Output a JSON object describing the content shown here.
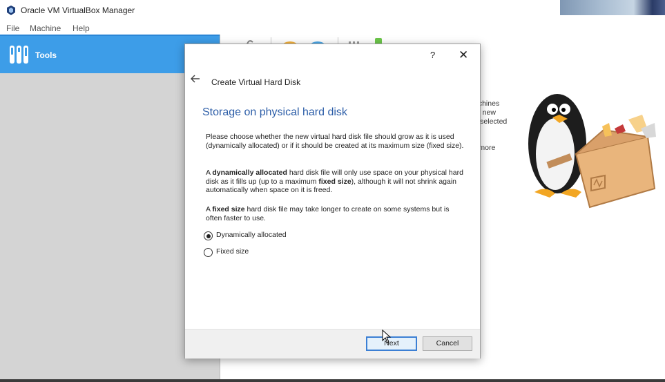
{
  "window": {
    "title": "Oracle VM VirtualBox Manager"
  },
  "menu": {
    "items": [
      "File",
      "Machine",
      "Help"
    ]
  },
  "sidebar": {
    "tools_label": "Tools"
  },
  "colors": {
    "accent": "#3d9de8",
    "heading_blue": "#2d5ea8",
    "sidebar_bg": "#d4d4d4"
  },
  "welcome_fragments": [
    "achines",
    "te new",
    "y selected",
    "r more"
  ],
  "dialog": {
    "help": "?",
    "close": "✕",
    "title": "Create Virtual Hard Disk",
    "heading": "Storage on physical hard disk",
    "para1": "Please choose whether the new virtual hard disk file should grow as it is used (dynamically allocated) or if it should be created at its maximum size (fixed size).",
    "para2": {
      "t1": "A ",
      "b1": "dynamically allocated",
      "t2": " hard disk file will only use space on your physical hard disk as it fills up (up to a maximum ",
      "b2": "fixed size",
      "t3": "), although it will not shrink again automatically when space on it is freed."
    },
    "para3": {
      "t1": "A ",
      "b1": "fixed size",
      "t2": " hard disk file may take longer to create on some systems but is often faster to use."
    },
    "options": [
      {
        "label": "Dynamically allocated",
        "selected": true
      },
      {
        "label": "Fixed size",
        "selected": false
      }
    ],
    "next_label": "Next",
    "cancel_label": "Cancel"
  }
}
